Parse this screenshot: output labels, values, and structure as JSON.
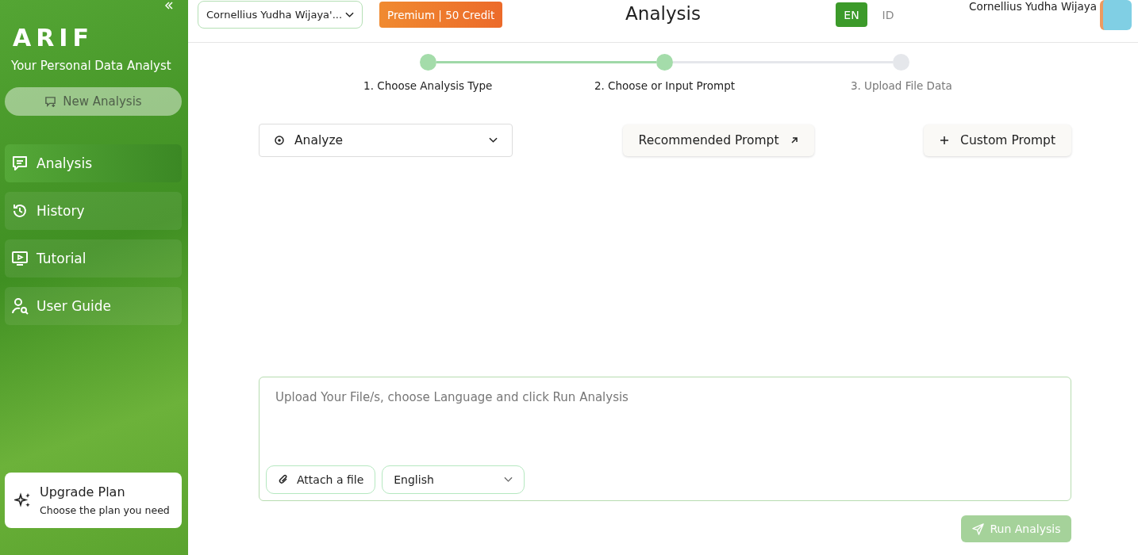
{
  "sidebar": {
    "logo": "ARIF",
    "tagline": "Your Personal Data Analyst",
    "new_button": "New Analysis",
    "items": [
      {
        "label": "Analysis",
        "selected": true,
        "kind": "chat"
      },
      {
        "label": "History",
        "selected": false,
        "kind": "history"
      },
      {
        "label": "Tutorial",
        "selected": false,
        "kind": "video"
      },
      {
        "label": "User Guide",
        "selected": false,
        "kind": "guide"
      }
    ],
    "upgrade": {
      "title": "Upgrade Plan",
      "subtitle": "Choose the plan you need"
    }
  },
  "header": {
    "workspace": "Cornellius Yudha Wijaya'...",
    "plan_badge": "Premium | 50 Credit",
    "title": "Analysis",
    "languages": [
      {
        "label": "EN",
        "selected": true
      },
      {
        "label": "ID",
        "selected": false
      }
    ],
    "user_name": "Cornellius Yudha Wijaya"
  },
  "steps": [
    {
      "label": "1. Choose Analysis Type",
      "completed": true
    },
    {
      "label": "2. Choose or Input Prompt",
      "completed": true
    },
    {
      "label": "3. Upload File Data",
      "completed": false
    }
  ],
  "analysis_type": "Analyze",
  "recommended_button": "Recommended Prompt",
  "custom_button": "Custom Prompt",
  "prompt": {
    "placeholder": "Upload Your File/s, choose Language and click Run Analysis",
    "attach_button": "Attach a file",
    "language": "English"
  },
  "run_button": {
    "label": "Run Analysis",
    "disabled": true
  }
}
